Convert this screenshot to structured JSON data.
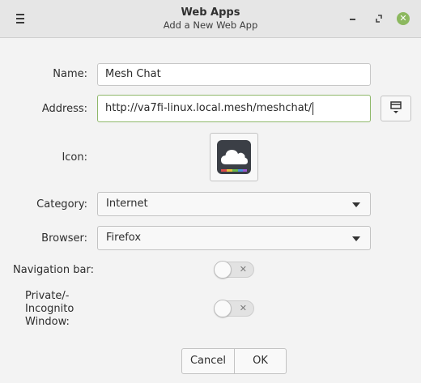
{
  "window": {
    "title": "Web Apps",
    "subtitle": "Add a New Web App"
  },
  "form": {
    "name_label": "Name:",
    "name_value": "Mesh Chat",
    "address_label": "Address:",
    "address_value": "http://va7fi-linux.local.mesh/meshchat/",
    "icon_label": "Icon:",
    "category_label": "Category:",
    "category_value": "Internet",
    "browser_label": "Browser:",
    "browser_value": "Firefox",
    "navbar_label": "Navigation bar:",
    "navbar_on": false,
    "private_label_1": "Private/-",
    "private_label_2": "Incognito",
    "private_label_3": "Window:",
    "private_on": false
  },
  "icons": {
    "menu": "hamburger-menu-icon",
    "favicon_button": "download-favicon-icon",
    "app_icon": "cloud-app-icon",
    "minimize": "minimize-icon",
    "maximize": "maximize-icon",
    "close": "close-icon"
  },
  "buttons": {
    "cancel": "Cancel",
    "ok": "OK"
  },
  "colors": {
    "accent": "#8cb85f",
    "focus_border": "#8fb86a"
  }
}
